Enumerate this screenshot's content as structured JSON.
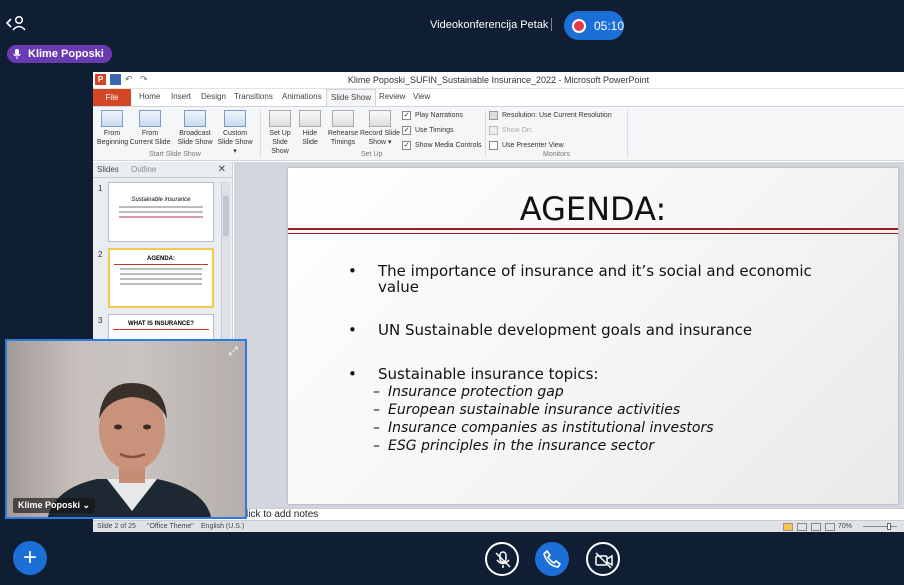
{
  "meeting": {
    "title": "Videokonferencija Petak",
    "timer": "05:10",
    "active_speaker": "Klime Poposki"
  },
  "ppt": {
    "window_title": "Klime Poposki_SUFIN_Sustainable Insurance_2022  -  Microsoft PowerPoint",
    "tabs": [
      "File",
      "Home",
      "Insert",
      "Design",
      "Transitions",
      "Animations",
      "Slide Show",
      "Review",
      "View"
    ],
    "active_tab": "Slide Show",
    "ribbon": {
      "start": {
        "from_beginning": [
          "From",
          "Beginning"
        ],
        "from_current": [
          "From",
          "Current Slide"
        ],
        "broadcast": [
          "Broadcast",
          "Slide Show"
        ],
        "custom": [
          "Custom",
          "Slide Show ▾"
        ],
        "group_label": "Start Slide Show"
      },
      "setup": {
        "set_up": [
          "Set Up",
          "Slide Show"
        ],
        "hide": [
          "Hide",
          "Slide"
        ],
        "rehearse": [
          "Rehearse",
          "Timings"
        ],
        "record": [
          "Record Slide",
          "Show ▾"
        ],
        "play_narrations": "Play Narrations",
        "use_timings": "Use Timings",
        "show_media_controls": "Show Media Controls",
        "group_label": "Set Up"
      },
      "monitors": {
        "resolution": "Resolution:  Use Current Resolution",
        "show_on": "Show On:",
        "presenter_view": "Use Presenter View",
        "group_label": "Monitors"
      }
    },
    "panel_tabs": {
      "slides": "Slides",
      "outline": "Outline"
    },
    "thumbnails": [
      {
        "num": "1",
        "title": "Sustainable insurance"
      },
      {
        "num": "2",
        "title": "AGENDA:"
      },
      {
        "num": "3",
        "title": "WHAT IS INSURANCE?"
      }
    ],
    "slide": {
      "title": "AGENDA:",
      "bullets": [
        {
          "line1": "The importance of insurance and it’s social and economic",
          "line2": "value"
        },
        {
          "line1": "UN Sustainable development goals and insurance"
        },
        {
          "line1": "Sustainable insurance topics:"
        }
      ],
      "subitems": [
        "Insurance protection gap",
        "European sustainable insurance activities",
        "Insurance companies as institutional investors",
        "ESG principles in the insurance sector"
      ]
    },
    "notes_placeholder": "lick to add notes",
    "status": {
      "slide": "Slide 2 of 25",
      "theme": "\"Office Theme\"",
      "language": "English (U.S.)",
      "zoom": "70%"
    }
  },
  "self_video": {
    "name": "Klime Poposki ⌄"
  }
}
